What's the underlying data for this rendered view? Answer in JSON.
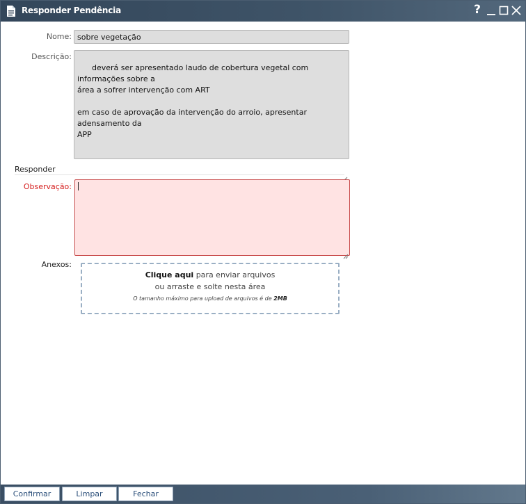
{
  "window": {
    "title": "Responder Pendência",
    "help_label": "?"
  },
  "form": {
    "name_label": "Nome:",
    "name_value": "sobre vegetação",
    "description_label": "Descrição:",
    "description_value": "deverá ser apresentado laudo de cobertura vegetal com informações sobre a\nárea a sofrer intervenção com ART\n\nem caso de aprovação da intervenção do arroio, apresentar adensamento da\nAPP",
    "section_title": "Responder",
    "observation_label": "Observação:",
    "observation_value": "",
    "attachments_label": "Anexos:"
  },
  "dropzone": {
    "link_text": "Clique aqui",
    "line1_rest": " para enviar arquivos",
    "line2": "ou arraste e solte nesta área",
    "limit_text": "O tamanho máximo para upload de arquivos é de ",
    "limit_value": "2MB"
  },
  "footer": {
    "confirm_label": "Confirmar",
    "clear_label": "Limpar",
    "close_label": "Fechar"
  },
  "colors": {
    "titlebar": "#33465a",
    "required": "#d62020",
    "error_fill": "#ffe3e3",
    "button_text": "#2b4f7a"
  },
  "icons": {
    "title": "document-icon",
    "help": "help-icon",
    "minimize": "minimize-icon",
    "maximize": "maximize-icon",
    "close": "close-icon"
  }
}
